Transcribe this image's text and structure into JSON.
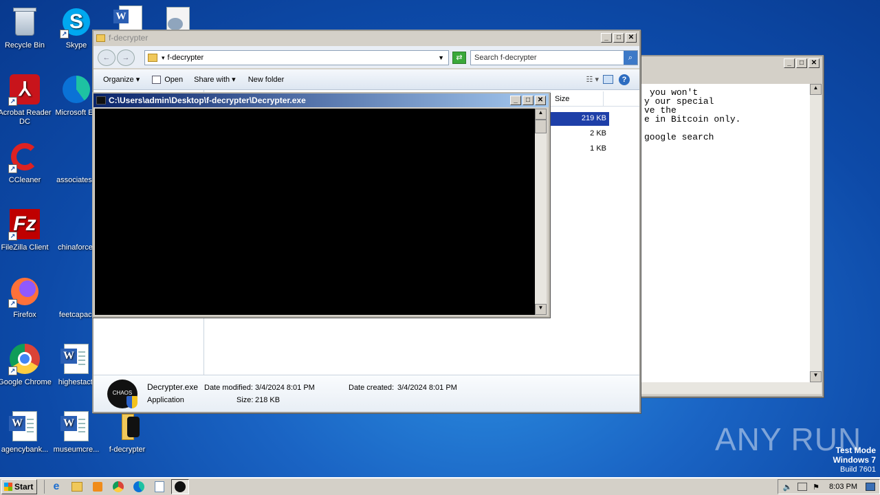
{
  "desktop": {
    "icons": [
      {
        "label": "Recycle Bin",
        "icon": "recycle-bin-icon"
      },
      {
        "label": "Skype",
        "icon": "skype-icon"
      },
      {
        "label": "Acrobat Reader DC",
        "icon": "acrobat-icon"
      },
      {
        "label": "Microsoft Ed",
        "icon": "edge-icon"
      },
      {
        "label": "CCleaner",
        "icon": "ccleaner-icon"
      },
      {
        "label": "associatese",
        "icon": "word-doc-icon"
      },
      {
        "label": "FileZilla Client",
        "icon": "filezilla-icon"
      },
      {
        "label": "chinaforce.",
        "icon": "word-doc-icon"
      },
      {
        "label": "Firefox",
        "icon": "firefox-icon"
      },
      {
        "label": "feetcapaci",
        "icon": "word-doc-icon"
      },
      {
        "label": "Google Chrome",
        "icon": "chrome-icon"
      },
      {
        "label": "highestacti",
        "icon": "word-doc-icon"
      },
      {
        "label": "agencybank...",
        "icon": "word-doc-icon"
      },
      {
        "label": "museumcre...",
        "icon": "word-doc-icon"
      },
      {
        "label": "f-decrypter",
        "icon": "folder-icon"
      }
    ]
  },
  "notepad": {
    "lines": [
      "you won't",
      "y our special",
      "ve the",
      "e in Bitcoin only.",
      "",
      "google search"
    ]
  },
  "explorer": {
    "title": "f-decrypter",
    "address": "f-decrypter",
    "search_placeholder": "Search f-decrypter",
    "toolbar": {
      "organize": "Organize",
      "open": "Open",
      "share_with": "Share with",
      "new_folder": "New folder"
    },
    "column_size": "Size",
    "rows": [
      {
        "size": "219 KB",
        "selected": true
      },
      {
        "size": "2 KB",
        "selected": false
      },
      {
        "size": "1 KB",
        "selected": false
      }
    ],
    "details": {
      "name": "Decrypter.exe",
      "type": "Application",
      "date_modified_label": "Date modified:",
      "date_modified": "3/4/2024 8:01 PM",
      "date_created_label": "Date created:",
      "date_created": "3/4/2024 8:01 PM",
      "size_label": "Size:",
      "size": "218 KB",
      "icon_text": "CHAOS"
    }
  },
  "console": {
    "title": "C:\\Users\\admin\\Desktop\\f-decrypter\\Decrypter.exe"
  },
  "watermark": {
    "brand": "ANY RUN",
    "line1": "Test Mode",
    "line2": "Windows 7",
    "line3": "Build 7601"
  },
  "taskbar": {
    "start": "Start",
    "clock": "8:03 PM"
  }
}
